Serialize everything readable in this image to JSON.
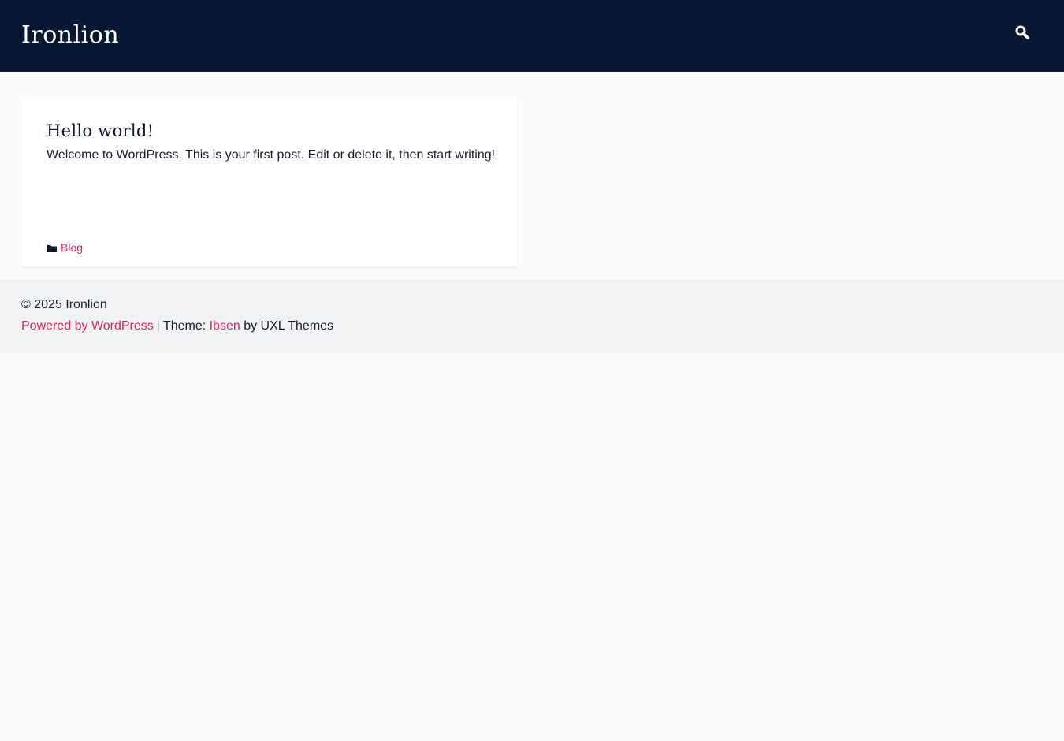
{
  "header": {
    "site_title": "Ironlion",
    "search_icon": "search-icon"
  },
  "post": {
    "title": "Hello world!",
    "excerpt": "Welcome to WordPress. This is your first post. Edit or delete it, then start writing!",
    "category_icon": "folder-icon",
    "category": "Blog"
  },
  "footer": {
    "copyright": "© 2025 Ironlion",
    "powered_by": "Powered by WordPress",
    "separator": "|",
    "theme_prefix": "Theme: ",
    "theme_name": "Ibsen",
    "theme_suffix": " by UXL Themes"
  },
  "colors": {
    "header_bg": "#081733",
    "accent": "#e0245e",
    "footer_bg": "#f0f2f4",
    "page_bg": "#fcfcfc"
  }
}
